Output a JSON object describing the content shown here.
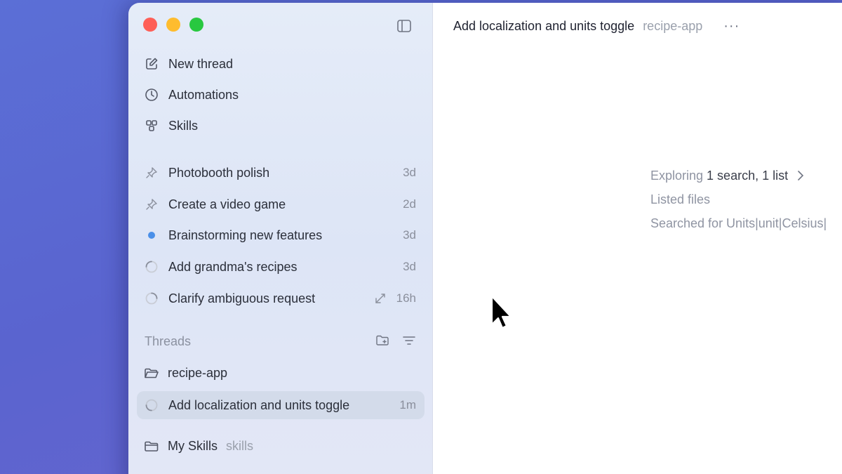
{
  "window": {
    "title": "Add localization and units toggle",
    "project": "recipe-app",
    "more_label": "···"
  },
  "sidebar": {
    "nav": [
      {
        "label": "New thread",
        "icon": "compose-icon"
      },
      {
        "label": "Automations",
        "icon": "clock-icon"
      },
      {
        "label": "Skills",
        "icon": "skills-icon"
      }
    ],
    "pinned": [
      {
        "label": "Photobooth polish",
        "time": "3d",
        "icon": "pin-icon"
      },
      {
        "label": "Create a video game",
        "time": "2d",
        "icon": "pin-icon"
      },
      {
        "label": "Brainstorming new features",
        "time": "3d",
        "icon": "unread-dot"
      },
      {
        "label": "Add grandma's recipes",
        "time": "3d",
        "icon": "spinner-icon"
      },
      {
        "label": "Clarify ambiguous request",
        "time": "16h",
        "icon": "spinner-icon"
      }
    ],
    "section_title": "Threads",
    "projects": [
      {
        "label": "recipe-app"
      },
      {
        "label": "My Skills",
        "sub": "skills"
      }
    ],
    "active_thread": {
      "label": "Add localization and units toggle",
      "time": "1m"
    }
  },
  "main": {
    "activity": {
      "exploring_label": "Exploring",
      "exploring_detail": "1 search, 1 list",
      "listed": "Listed files",
      "searched": "Searched for Units|unit|Celsius|"
    }
  },
  "colors": {
    "accent_dot": "#4a8fe8",
    "close": "#fe5f57",
    "minimize": "#febc2e",
    "zoom": "#28c840"
  }
}
